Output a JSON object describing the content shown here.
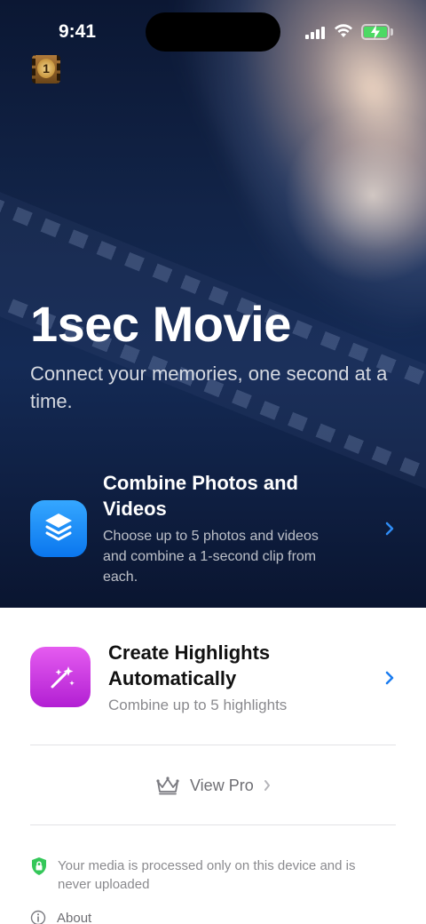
{
  "status_bar": {
    "time": "9:41"
  },
  "app_badge": {
    "number": "1"
  },
  "hero": {
    "title": "1sec Movie",
    "subtitle": "Connect your memories, one second at a time."
  },
  "options": [
    {
      "title": "Combine Photos and Videos",
      "description": "Choose up to 5 photos and videos and combine a 1-second clip from each.",
      "icon": "layers-icon",
      "color": "#1a8cff"
    },
    {
      "title": "Create Highlights Automatically",
      "description": "Combine up to 5 highlights",
      "icon": "magic-wand-icon",
      "color": "#cc3ae6"
    }
  ],
  "view_pro": {
    "label": "View Pro",
    "icon": "crown-icon"
  },
  "privacy": {
    "text": "Your media is processed only on this device and is never uploaded",
    "icon": "shield-lock-icon",
    "color": "#34c759"
  },
  "about": {
    "label": "About",
    "icon": "info-icon"
  },
  "colors": {
    "accent": "#1a7cf0",
    "hero_background": "#122448"
  }
}
